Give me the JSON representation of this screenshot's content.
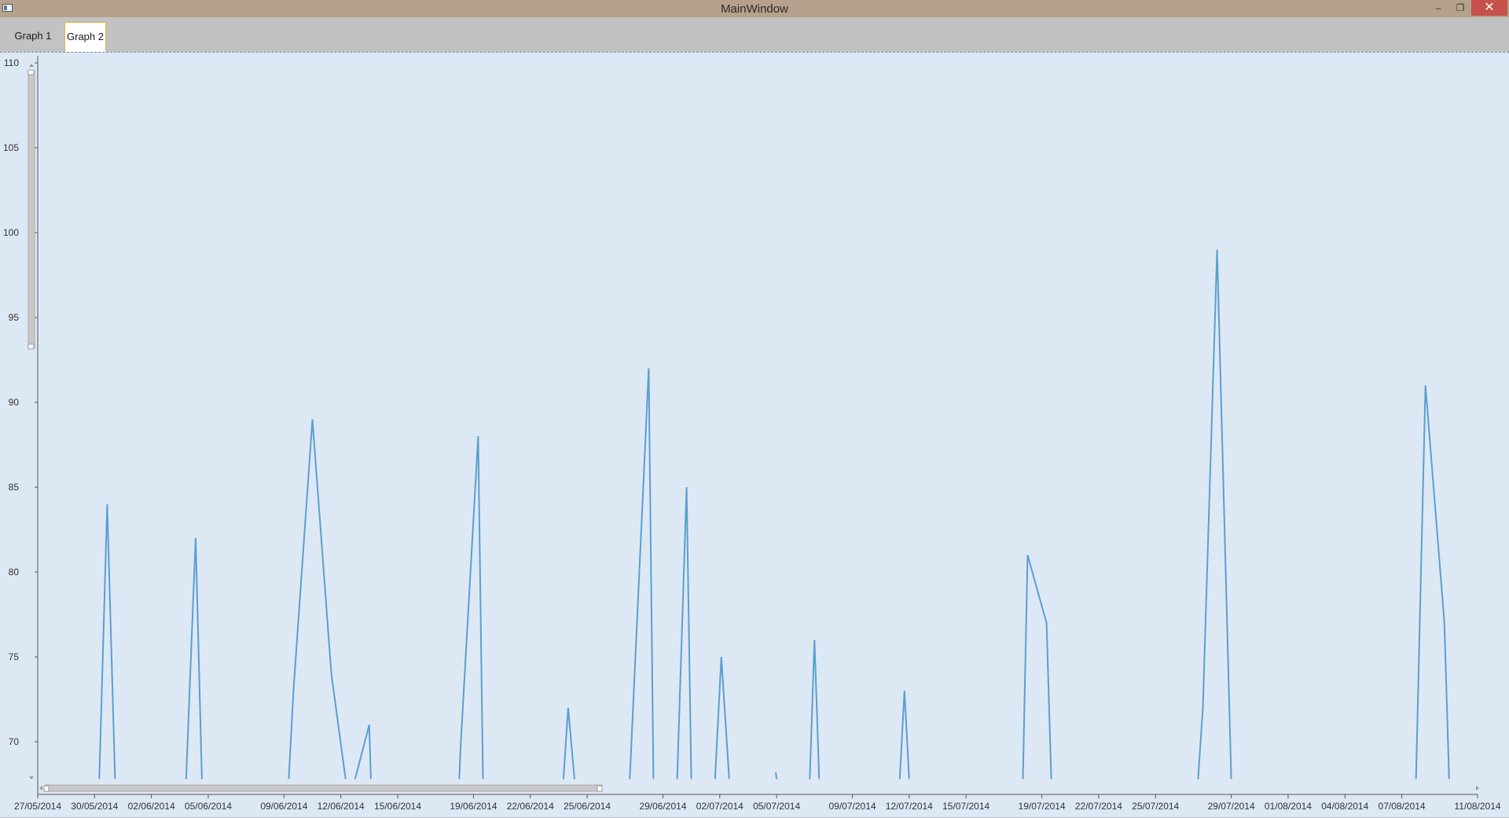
{
  "window": {
    "title": "MainWindow",
    "minimize": "‒",
    "restore": "❐",
    "close": "✕"
  },
  "tabs": [
    {
      "label": "Graph 1"
    },
    {
      "label": "Graph 2"
    }
  ],
  "chart_data": {
    "type": "line",
    "title": "",
    "xlabel": "",
    "ylabel": "",
    "ylim": [
      67.8,
      110
    ],
    "xlim": [
      "2014-05-27",
      "2014-08-11"
    ],
    "y_ticks": [
      70,
      75,
      80,
      85,
      90,
      95,
      100,
      105,
      110
    ],
    "x_ticks": [
      "27/05/2014",
      "30/05/2014",
      "02/06/2014",
      "05/06/2014",
      "09/06/2014",
      "12/06/2014",
      "15/06/2014",
      "19/06/2014",
      "22/06/2014",
      "25/06/2014",
      "29/06/2014",
      "02/07/2014",
      "05/07/2014",
      "09/07/2014",
      "12/07/2014",
      "15/07/2014",
      "19/07/2014",
      "22/07/2014",
      "25/07/2014",
      "29/07/2014",
      "01/08/2014",
      "04/08/2014",
      "07/08/2014",
      "11/08/2014"
    ],
    "series": [
      {
        "color": "#5a9fd0",
        "segments": [
          [
            [
              "2014-05-30T06:00",
              67.8
            ],
            [
              "2014-05-30T16:00",
              84
            ],
            [
              "2014-05-31T02:00",
              67.8
            ]
          ],
          [
            [
              "2014-06-03T20:00",
              67.8
            ],
            [
              "2014-06-04T08:00",
              82
            ],
            [
              "2014-06-04T16:00",
              67.8
            ]
          ],
          [
            [
              "2014-06-09T06:00",
              67.8
            ],
            [
              "2014-06-09T12:00",
              73
            ],
            [
              "2014-06-10T12:00",
              89
            ],
            [
              "2014-06-11T12:00",
              74
            ],
            [
              "2014-06-12T06:00",
              67.8
            ]
          ],
          [
            [
              "2014-06-12T18:00",
              67.8
            ],
            [
              "2014-06-13T12:00",
              71
            ],
            [
              "2014-06-13T14:00",
              67.8
            ]
          ],
          [
            [
              "2014-06-18T06:00",
              67.8
            ],
            [
              "2014-06-18T08:00",
              70
            ],
            [
              "2014-06-19T06:00",
              88
            ],
            [
              "2014-06-19T12:00",
              67.8
            ]
          ],
          [
            [
              "2014-06-23T18:00",
              67.8
            ],
            [
              "2014-06-24T00:00",
              72
            ],
            [
              "2014-06-24T08:00",
              67.8
            ]
          ],
          [
            [
              "2014-06-27T06:00",
              67.8
            ],
            [
              "2014-06-28T06:00",
              92
            ],
            [
              "2014-06-28T12:00",
              67.8
            ]
          ],
          [
            [
              "2014-06-29T18:00",
              67.8
            ],
            [
              "2014-06-30T06:00",
              85
            ],
            [
              "2014-06-30T12:00",
              67.8
            ]
          ],
          [
            [
              "2014-07-01T18:00",
              67.8
            ],
            [
              "2014-07-02T02:00",
              75
            ],
            [
              "2014-07-02T12:00",
              67.8
            ]
          ],
          [
            [
              "2014-07-04T23:00",
              68.2
            ],
            [
              "2014-07-05T00:00",
              67.8
            ]
          ],
          [
            [
              "2014-07-06T18:00",
              67.8
            ],
            [
              "2014-07-07T00:00",
              76
            ],
            [
              "2014-07-07T06:00",
              67.8
            ]
          ],
          [
            [
              "2014-07-11T12:00",
              67.8
            ],
            [
              "2014-07-11T18:00",
              73
            ],
            [
              "2014-07-12T00:00",
              67.8
            ]
          ],
          [
            [
              "2014-07-18T00:00",
              67.8
            ],
            [
              "2014-07-18T06:00",
              81
            ],
            [
              "2014-07-19T06:00",
              77
            ],
            [
              "2014-07-19T12:00",
              67.8
            ]
          ],
          [
            [
              "2014-07-27T06:00",
              67.8
            ],
            [
              "2014-07-27T12:00",
              72
            ],
            [
              "2014-07-28T06:00",
              99
            ],
            [
              "2014-07-29T00:00",
              67.8
            ]
          ],
          [
            [
              "2014-08-07T18:00",
              67.8
            ],
            [
              "2014-08-08T06:00",
              91
            ],
            [
              "2014-08-09T06:00",
              77
            ],
            [
              "2014-08-09T12:00",
              67.8
            ]
          ]
        ]
      }
    ]
  }
}
